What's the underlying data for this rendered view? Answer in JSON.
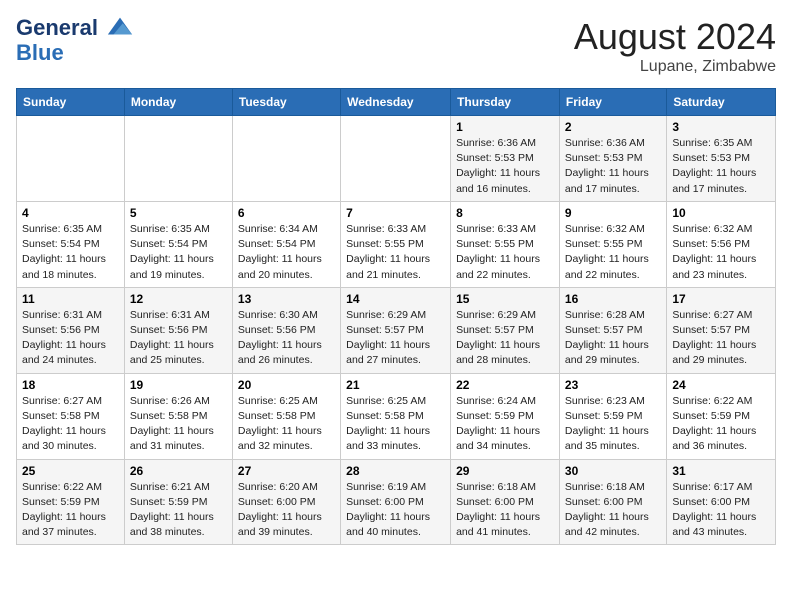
{
  "header": {
    "logo_line1": "General",
    "logo_line2": "Blue",
    "month_year": "August 2024",
    "location": "Lupane, Zimbabwe"
  },
  "days_of_week": [
    "Sunday",
    "Monday",
    "Tuesday",
    "Wednesday",
    "Thursday",
    "Friday",
    "Saturday"
  ],
  "weeks": [
    [
      {
        "day": "",
        "info": ""
      },
      {
        "day": "",
        "info": ""
      },
      {
        "day": "",
        "info": ""
      },
      {
        "day": "",
        "info": ""
      },
      {
        "day": "1",
        "info": "Sunrise: 6:36 AM\nSunset: 5:53 PM\nDaylight: 11 hours and 16 minutes."
      },
      {
        "day": "2",
        "info": "Sunrise: 6:36 AM\nSunset: 5:53 PM\nDaylight: 11 hours and 17 minutes."
      },
      {
        "day": "3",
        "info": "Sunrise: 6:35 AM\nSunset: 5:53 PM\nDaylight: 11 hours and 17 minutes."
      }
    ],
    [
      {
        "day": "4",
        "info": "Sunrise: 6:35 AM\nSunset: 5:54 PM\nDaylight: 11 hours and 18 minutes."
      },
      {
        "day": "5",
        "info": "Sunrise: 6:35 AM\nSunset: 5:54 PM\nDaylight: 11 hours and 19 minutes."
      },
      {
        "day": "6",
        "info": "Sunrise: 6:34 AM\nSunset: 5:54 PM\nDaylight: 11 hours and 20 minutes."
      },
      {
        "day": "7",
        "info": "Sunrise: 6:33 AM\nSunset: 5:55 PM\nDaylight: 11 hours and 21 minutes."
      },
      {
        "day": "8",
        "info": "Sunrise: 6:33 AM\nSunset: 5:55 PM\nDaylight: 11 hours and 22 minutes."
      },
      {
        "day": "9",
        "info": "Sunrise: 6:32 AM\nSunset: 5:55 PM\nDaylight: 11 hours and 22 minutes."
      },
      {
        "day": "10",
        "info": "Sunrise: 6:32 AM\nSunset: 5:56 PM\nDaylight: 11 hours and 23 minutes."
      }
    ],
    [
      {
        "day": "11",
        "info": "Sunrise: 6:31 AM\nSunset: 5:56 PM\nDaylight: 11 hours and 24 minutes."
      },
      {
        "day": "12",
        "info": "Sunrise: 6:31 AM\nSunset: 5:56 PM\nDaylight: 11 hours and 25 minutes."
      },
      {
        "day": "13",
        "info": "Sunrise: 6:30 AM\nSunset: 5:56 PM\nDaylight: 11 hours and 26 minutes."
      },
      {
        "day": "14",
        "info": "Sunrise: 6:29 AM\nSunset: 5:57 PM\nDaylight: 11 hours and 27 minutes."
      },
      {
        "day": "15",
        "info": "Sunrise: 6:29 AM\nSunset: 5:57 PM\nDaylight: 11 hours and 28 minutes."
      },
      {
        "day": "16",
        "info": "Sunrise: 6:28 AM\nSunset: 5:57 PM\nDaylight: 11 hours and 29 minutes."
      },
      {
        "day": "17",
        "info": "Sunrise: 6:27 AM\nSunset: 5:57 PM\nDaylight: 11 hours and 29 minutes."
      }
    ],
    [
      {
        "day": "18",
        "info": "Sunrise: 6:27 AM\nSunset: 5:58 PM\nDaylight: 11 hours and 30 minutes."
      },
      {
        "day": "19",
        "info": "Sunrise: 6:26 AM\nSunset: 5:58 PM\nDaylight: 11 hours and 31 minutes."
      },
      {
        "day": "20",
        "info": "Sunrise: 6:25 AM\nSunset: 5:58 PM\nDaylight: 11 hours and 32 minutes."
      },
      {
        "day": "21",
        "info": "Sunrise: 6:25 AM\nSunset: 5:58 PM\nDaylight: 11 hours and 33 minutes."
      },
      {
        "day": "22",
        "info": "Sunrise: 6:24 AM\nSunset: 5:59 PM\nDaylight: 11 hours and 34 minutes."
      },
      {
        "day": "23",
        "info": "Sunrise: 6:23 AM\nSunset: 5:59 PM\nDaylight: 11 hours and 35 minutes."
      },
      {
        "day": "24",
        "info": "Sunrise: 6:22 AM\nSunset: 5:59 PM\nDaylight: 11 hours and 36 minutes."
      }
    ],
    [
      {
        "day": "25",
        "info": "Sunrise: 6:22 AM\nSunset: 5:59 PM\nDaylight: 11 hours and 37 minutes."
      },
      {
        "day": "26",
        "info": "Sunrise: 6:21 AM\nSunset: 5:59 PM\nDaylight: 11 hours and 38 minutes."
      },
      {
        "day": "27",
        "info": "Sunrise: 6:20 AM\nSunset: 6:00 PM\nDaylight: 11 hours and 39 minutes."
      },
      {
        "day": "28",
        "info": "Sunrise: 6:19 AM\nSunset: 6:00 PM\nDaylight: 11 hours and 40 minutes."
      },
      {
        "day": "29",
        "info": "Sunrise: 6:18 AM\nSunset: 6:00 PM\nDaylight: 11 hours and 41 minutes."
      },
      {
        "day": "30",
        "info": "Sunrise: 6:18 AM\nSunset: 6:00 PM\nDaylight: 11 hours and 42 minutes."
      },
      {
        "day": "31",
        "info": "Sunrise: 6:17 AM\nSunset: 6:00 PM\nDaylight: 11 hours and 43 minutes."
      }
    ]
  ]
}
